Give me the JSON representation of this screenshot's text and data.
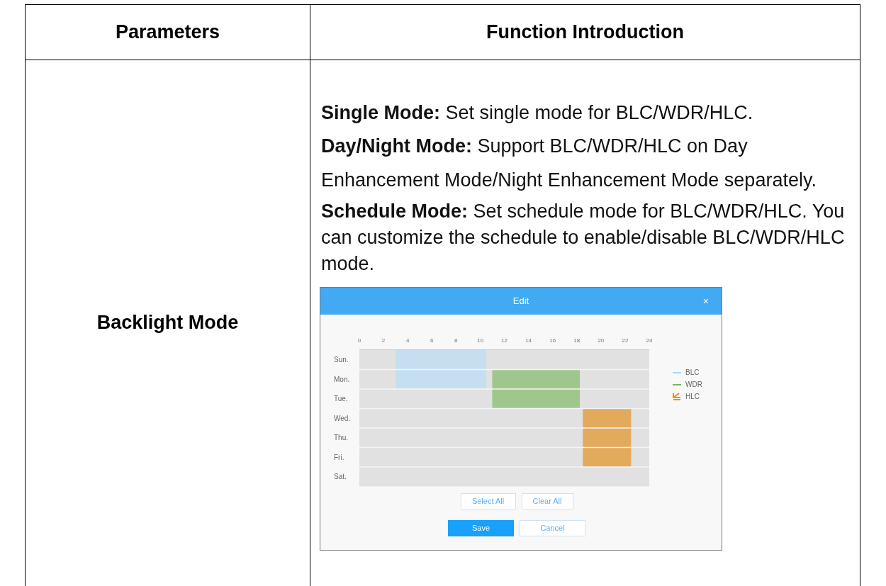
{
  "table": {
    "columns": [
      "Parameters",
      "Function Introduction"
    ],
    "rows": [
      {
        "parameter": "Backlight Mode",
        "paragraphs": [
          "**Single Mode:** Set single mode for BLC/WDR/HLC.",
          "**Day/Night Mode:** Support BLC/WDR/HLC on Day Enhancement Mode/Night Enhancement Mode separately.",
          "**Schedule Mode:** Set schedule mode for BLC/WDR/HLC. You can customize the schedule to enable/disable BLC/WDR/HLC mode."
        ],
        "dialog": {
          "title": "Edit",
          "close": "×",
          "ticks": [
            "0",
            "2",
            "4",
            "6",
            "8",
            "10",
            "12",
            "14",
            "16",
            "18",
            "20",
            "22",
            "24"
          ],
          "days": [
            "Sun.",
            "Mon.",
            "Tue.",
            "Wed.",
            "Thu.",
            "Fri.",
            "Sat."
          ],
          "legend": [
            {
              "label": "BLC",
              "color": "#a9d4f5",
              "kind": "line"
            },
            {
              "label": "WDR",
              "color": "#7ab65f",
              "kind": "line"
            },
            {
              "label": "HLC",
              "color": "#f08c00",
              "kind": "pen"
            }
          ],
          "buttons": [
            {
              "label": "Select All",
              "kind": "outline"
            },
            {
              "label": "Clear All",
              "kind": "outline"
            }
          ],
          "actions": [
            {
              "label": "Save",
              "kind": "primary"
            },
            {
              "label": "Cancel",
              "kind": "outline"
            }
          ]
        }
      }
    ]
  }
}
